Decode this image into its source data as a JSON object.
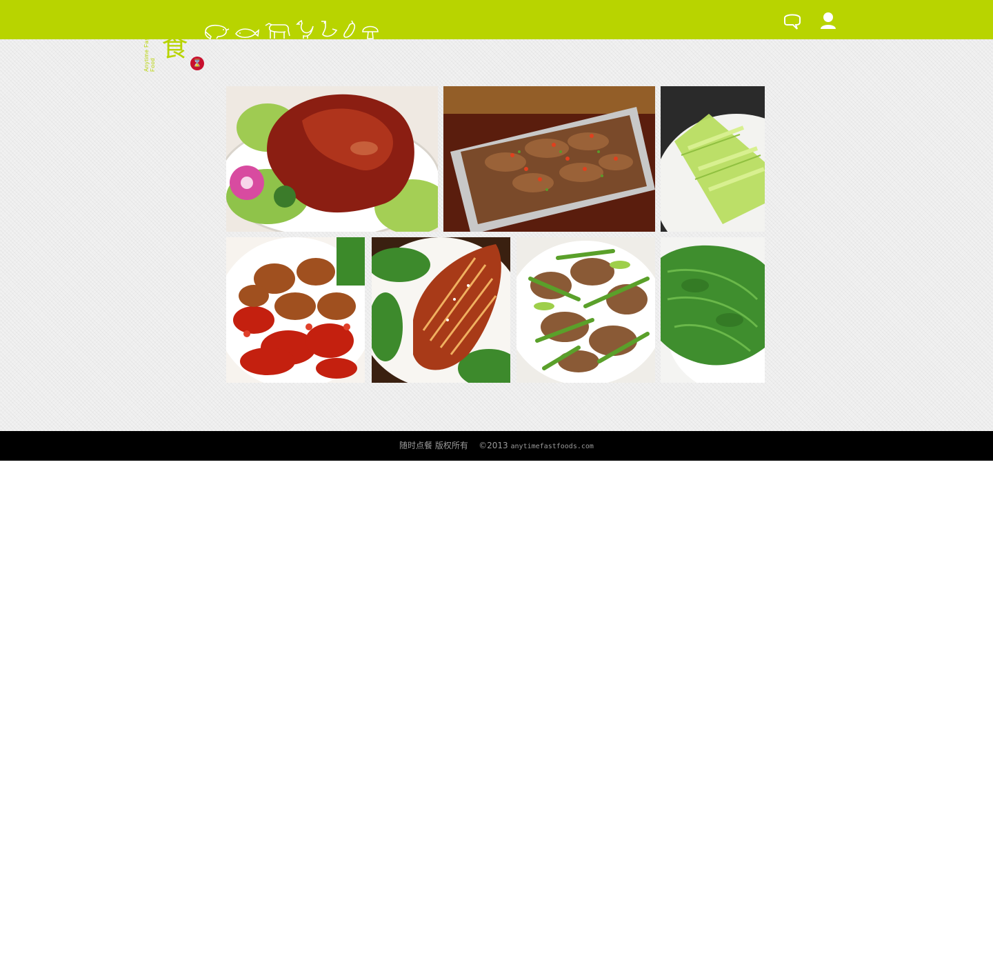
{
  "header": {
    "logo_text_cn": "随食",
    "logo_text_en": "Anytime Fast Food",
    "badge_icon": "hourglass-icon",
    "badge_glyph": "⌛",
    "brand_color": "#b8d400",
    "badge_color": "#c8102e",
    "categories": [
      {
        "icon": "pig-icon"
      },
      {
        "icon": "fish-icon"
      },
      {
        "icon": "cow-icon"
      },
      {
        "icon": "chicken-icon"
      },
      {
        "icon": "duck-icon"
      },
      {
        "icon": "eggplant-icon"
      },
      {
        "icon": "mushroom-icon"
      }
    ],
    "actions": [
      {
        "icon": "chat-bubble-icon"
      },
      {
        "icon": "user-icon"
      }
    ]
  },
  "gallery": {
    "items": [
      {
        "dish": "braised-pork-knuckle"
      },
      {
        "dish": "cumin-beef-on-foil"
      },
      {
        "dish": "sliced-celtuce"
      },
      {
        "dish": "spicy-chili-chicken"
      },
      {
        "dish": "glazed-squid"
      },
      {
        "dish": "stir-fried-pork-peppers"
      },
      {
        "dish": "lettuce-with-oyster-sauce"
      }
    ]
  },
  "footer": {
    "copyright_cn": "随时点餐 版权所有",
    "copyright_year": "©2013",
    "site": "anytimefastfoods.com"
  }
}
